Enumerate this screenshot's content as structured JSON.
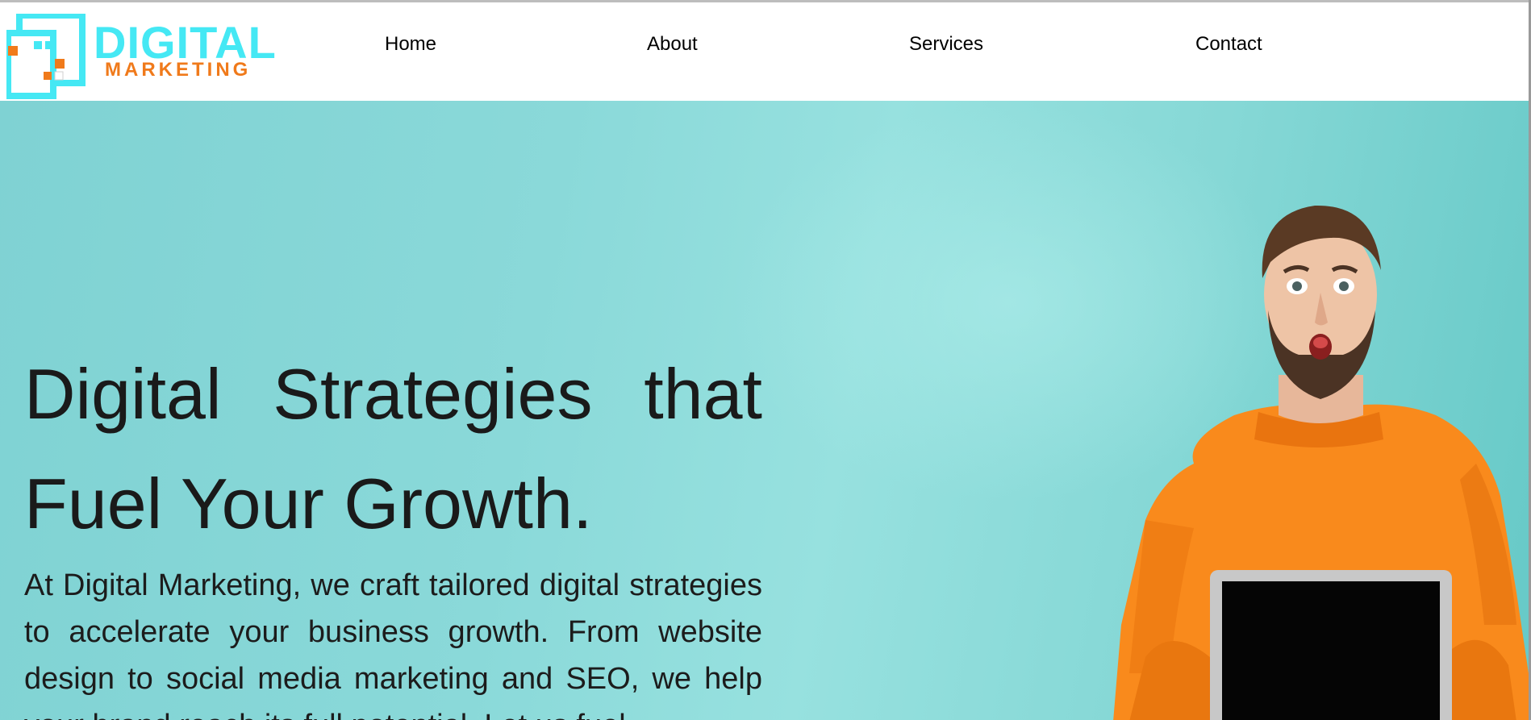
{
  "brand": {
    "word1": "DIGITAL",
    "word2": "MARKETING",
    "primary_color": "#45e8f4",
    "accent_color": "#f07a1b"
  },
  "nav": {
    "items": [
      {
        "label": "Home"
      },
      {
        "label": "About"
      },
      {
        "label": "Services"
      },
      {
        "label": "Contact"
      }
    ]
  },
  "hero": {
    "title": "Digital Strategies that Fuel Your Growth.",
    "text": "At Digital Marketing, we craft tailored digital strategies to accelerate your business growth. From website design to social media marketing and SEO, we help your brand reach its full potential. Let us fuel",
    "image_icon": "man-holding-laptop-photo",
    "background_color": "#8ad9d9",
    "text_color": "#1a1a1a"
  }
}
